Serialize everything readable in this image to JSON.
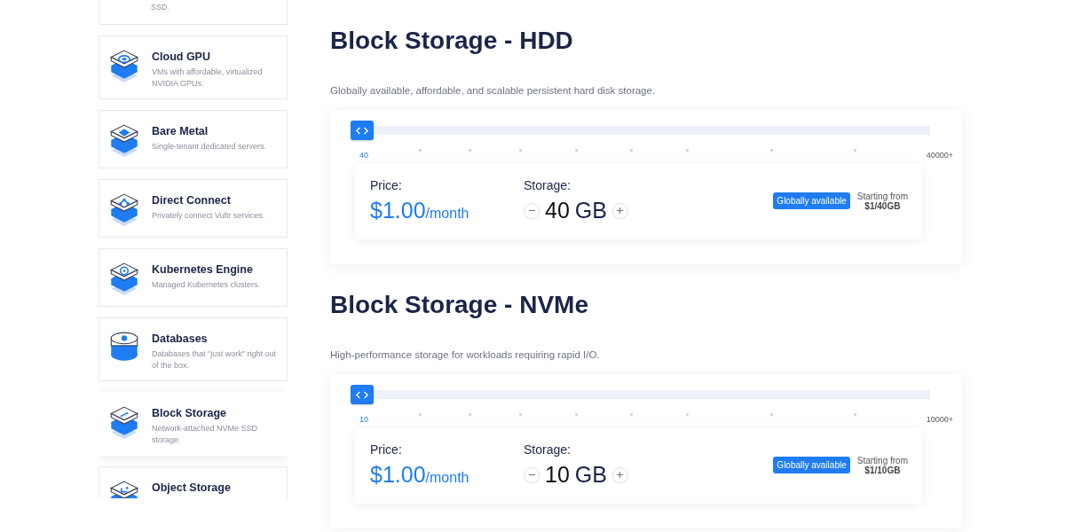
{
  "sidebar": {
    "items": [
      {
        "kind": "cut",
        "description": "SSD.",
        "selected": false
      },
      {
        "kind": "gpu",
        "title": "Cloud GPU",
        "description": "VMs with affordable, virtualized NVIDIA GPUs.",
        "selected": false
      },
      {
        "kind": "bare-metal",
        "title": "Bare Metal",
        "description": "Single-tenant dedicated servers.",
        "selected": false
      },
      {
        "kind": "direct-connect",
        "title": "Direct Connect",
        "description": "Privately connect Vultr services.",
        "selected": false
      },
      {
        "kind": "kubernetes",
        "title": "Kubernetes Engine",
        "description": "Managed Kubernetes clusters.",
        "selected": false
      },
      {
        "kind": "database",
        "title": "Databases",
        "description": "Databases that \"just work\" right out of the box.",
        "selected": false
      },
      {
        "kind": "block-storage",
        "title": "Block Storage",
        "description": "Network-attached NVMe SSD storage.",
        "selected": true
      },
      {
        "kind": "object-storage",
        "title": "Object Storage",
        "selected": false
      }
    ]
  },
  "sections": [
    {
      "title": "Block Storage - HDD",
      "description": "Globally available, affordable, and scalable persistent hard disk storage.",
      "slider": {
        "level": 0,
        "min_label": "40",
        "max_label": "40000+"
      },
      "price_label": "Price:",
      "price": "$1.00",
      "period": "/month",
      "storage_label": "Storage:",
      "storage_value": "40",
      "storage_unit": "GB",
      "badge": "Globally available",
      "starting_label": "Starting from",
      "starting_value": "$1/40GB"
    },
    {
      "title": "Block Storage - NVMe",
      "description": "High-performance storage for workloads requiring rapid I/O.",
      "slider": {
        "level": 0,
        "min_label": "10",
        "max_label": "10000+"
      },
      "price_label": "Price:",
      "price": "$1.00",
      "period": "/month",
      "storage_label": "Storage:",
      "storage_value": "10",
      "storage_unit": "GB",
      "badge": "Globally available",
      "starting_label": "Starting from",
      "starting_value": "$1/10GB"
    }
  ]
}
